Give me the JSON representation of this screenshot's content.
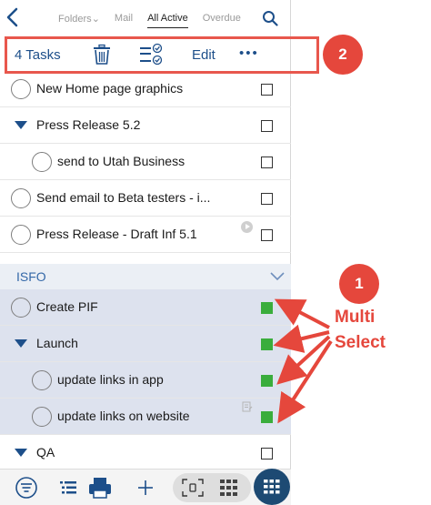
{
  "nav": {
    "tabs": [
      {
        "label": "Folders",
        "active": false
      },
      {
        "label": "Mail",
        "active": false
      },
      {
        "label": "All Active",
        "active": true
      },
      {
        "label": "Overdue",
        "active": false
      }
    ],
    "folders_chevron": "⌄"
  },
  "toolbar": {
    "task_count": "4 Tasks",
    "edit_label": "Edit",
    "more_label": "•••"
  },
  "annotations": {
    "badge_1": "1",
    "badge_2": "2",
    "multi_select_line1": "Multi",
    "multi_select_line2": "Select",
    "color": "#e5473c"
  },
  "tasks_top": [
    {
      "label": "New Home page graphics",
      "kind": "task"
    },
    {
      "label": "Press Release 5.2",
      "kind": "parent"
    },
    {
      "label": "send to Utah Business",
      "kind": "subtask"
    },
    {
      "label": "Send email to Beta testers - i...",
      "kind": "task"
    },
    {
      "label": "Press Release - Draft Inf 5.1",
      "kind": "task",
      "has_play_icon": true
    }
  ],
  "section": {
    "title": "ISFO"
  },
  "tasks_section": [
    {
      "label": "Create PIF",
      "kind": "task",
      "selected": true
    },
    {
      "label": "Launch",
      "kind": "parent",
      "selected": true
    },
    {
      "label": "update links in app",
      "kind": "subtask",
      "selected": true
    },
    {
      "label": "update links on website",
      "kind": "subtask",
      "selected": true,
      "has_note_icon": true
    },
    {
      "label": "QA",
      "kind": "parent",
      "selected": false
    }
  ],
  "colors": {
    "accent_blue": "#1d4f8a",
    "selected_row": "#dde2ee",
    "checkbox_green": "#3aad3c"
  }
}
